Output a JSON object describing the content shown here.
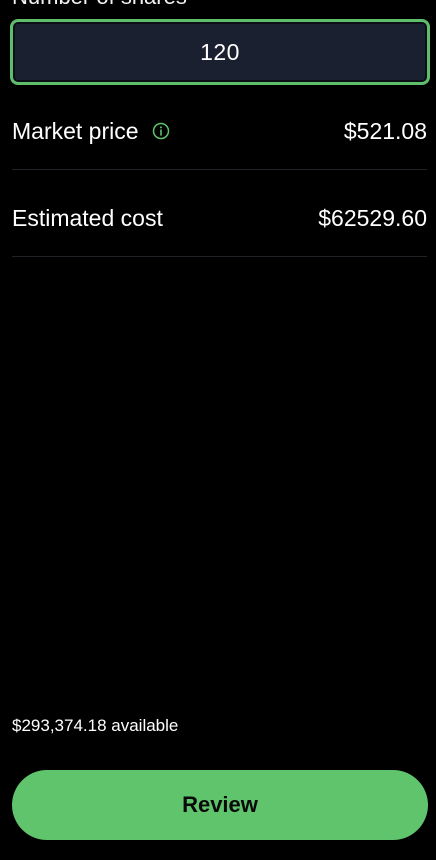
{
  "order": {
    "shares_label": "Number of shares",
    "shares_value": "120",
    "market_price_label": "Market price",
    "market_price_value": "$521.08",
    "estimated_cost_label": "Estimated cost",
    "estimated_cost_value": "$62529.60"
  },
  "footer": {
    "available_text": "$293,374.18 available",
    "review_label": "Review"
  },
  "icons": {
    "info": "info-icon"
  },
  "colors": {
    "background": "#000000",
    "accent_green": "#5fc46b",
    "input_background": "#1b2030",
    "divider": "#1f2226"
  }
}
